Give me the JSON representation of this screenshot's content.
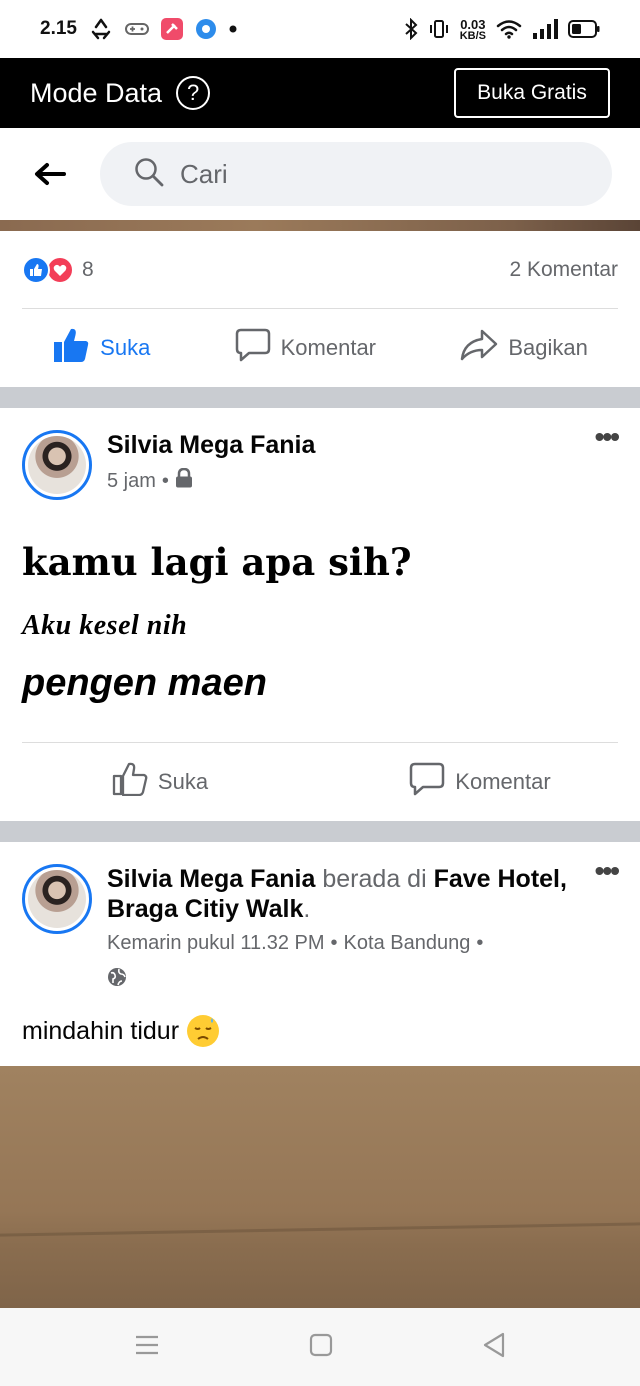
{
  "status_bar": {
    "time": "2.15",
    "net_speed_value": "0.03",
    "net_speed_unit": "KB/S"
  },
  "data_bar": {
    "title": "Mode Data",
    "help_symbol": "?",
    "free_button": "Buka Gratis"
  },
  "search": {
    "placeholder": "Cari"
  },
  "post1": {
    "reaction_count": "8",
    "comment_count": "2 Komentar",
    "actions": {
      "like": "Suka",
      "comment": "Komentar",
      "share": "Bagikan"
    }
  },
  "post2": {
    "author": "Silvia Mega Fania",
    "time": "5 jam",
    "separator": "•",
    "line1": "kamu lagi apa sih?",
    "line2": "Aku kesel nih",
    "line3": "pengen maen",
    "actions": {
      "like": "Suka",
      "comment": "Komentar"
    }
  },
  "post3": {
    "author": "Silvia Mega Fania",
    "at_text": "berada di",
    "place": "Fave Hotel, Braga Citiy Walk",
    "period": ".",
    "time": "Kemarin pukul 11.32 PM",
    "separator": "•",
    "location": "Kota Bandung",
    "body": "mindahin tidur"
  },
  "colors": {
    "accent": "#1877f2",
    "love": "#f33e58",
    "secondary_text": "#65676b",
    "separator": "#c9ccd1"
  },
  "icons": [
    "back-arrow-icon",
    "search-icon",
    "like-icon",
    "love-icon",
    "comment-icon",
    "share-icon",
    "more-icon",
    "lock-icon",
    "globe-icon",
    "emoji-icon"
  ]
}
